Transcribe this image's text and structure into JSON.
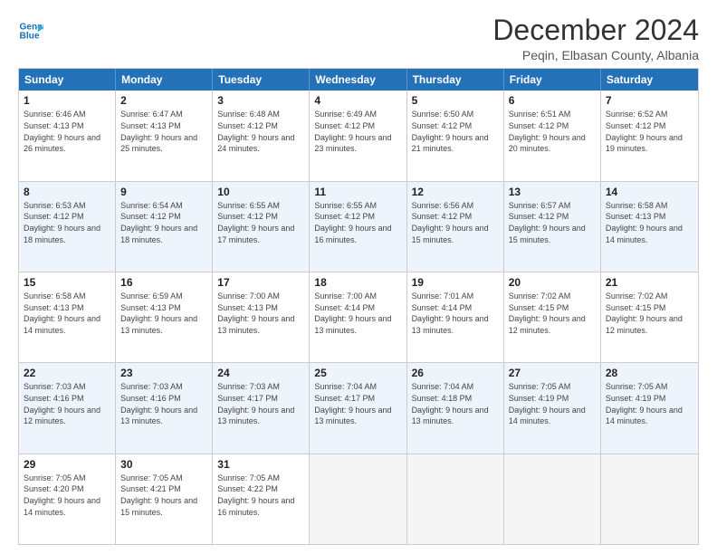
{
  "logo": {
    "line1": "General",
    "line2": "Blue",
    "arrow_color": "#2ea8e0"
  },
  "title": "December 2024",
  "subtitle": "Peqin, Elbasan County, Albania",
  "header_days": [
    "Sunday",
    "Monday",
    "Tuesday",
    "Wednesday",
    "Thursday",
    "Friday",
    "Saturday"
  ],
  "weeks": [
    [
      {
        "num": "1",
        "sunrise": "Sunrise: 6:46 AM",
        "sunset": "Sunset: 4:13 PM",
        "daylight": "Daylight: 9 hours and 26 minutes."
      },
      {
        "num": "2",
        "sunrise": "Sunrise: 6:47 AM",
        "sunset": "Sunset: 4:13 PM",
        "daylight": "Daylight: 9 hours and 25 minutes."
      },
      {
        "num": "3",
        "sunrise": "Sunrise: 6:48 AM",
        "sunset": "Sunset: 4:12 PM",
        "daylight": "Daylight: 9 hours and 24 minutes."
      },
      {
        "num": "4",
        "sunrise": "Sunrise: 6:49 AM",
        "sunset": "Sunset: 4:12 PM",
        "daylight": "Daylight: 9 hours and 23 minutes."
      },
      {
        "num": "5",
        "sunrise": "Sunrise: 6:50 AM",
        "sunset": "Sunset: 4:12 PM",
        "daylight": "Daylight: 9 hours and 21 minutes."
      },
      {
        "num": "6",
        "sunrise": "Sunrise: 6:51 AM",
        "sunset": "Sunset: 4:12 PM",
        "daylight": "Daylight: 9 hours and 20 minutes."
      },
      {
        "num": "7",
        "sunrise": "Sunrise: 6:52 AM",
        "sunset": "Sunset: 4:12 PM",
        "daylight": "Daylight: 9 hours and 19 minutes."
      }
    ],
    [
      {
        "num": "8",
        "sunrise": "Sunrise: 6:53 AM",
        "sunset": "Sunset: 4:12 PM",
        "daylight": "Daylight: 9 hours and 18 minutes."
      },
      {
        "num": "9",
        "sunrise": "Sunrise: 6:54 AM",
        "sunset": "Sunset: 4:12 PM",
        "daylight": "Daylight: 9 hours and 18 minutes."
      },
      {
        "num": "10",
        "sunrise": "Sunrise: 6:55 AM",
        "sunset": "Sunset: 4:12 PM",
        "daylight": "Daylight: 9 hours and 17 minutes."
      },
      {
        "num": "11",
        "sunrise": "Sunrise: 6:55 AM",
        "sunset": "Sunset: 4:12 PM",
        "daylight": "Daylight: 9 hours and 16 minutes."
      },
      {
        "num": "12",
        "sunrise": "Sunrise: 6:56 AM",
        "sunset": "Sunset: 4:12 PM",
        "daylight": "Daylight: 9 hours and 15 minutes."
      },
      {
        "num": "13",
        "sunrise": "Sunrise: 6:57 AM",
        "sunset": "Sunset: 4:12 PM",
        "daylight": "Daylight: 9 hours and 15 minutes."
      },
      {
        "num": "14",
        "sunrise": "Sunrise: 6:58 AM",
        "sunset": "Sunset: 4:13 PM",
        "daylight": "Daylight: 9 hours and 14 minutes."
      }
    ],
    [
      {
        "num": "15",
        "sunrise": "Sunrise: 6:58 AM",
        "sunset": "Sunset: 4:13 PM",
        "daylight": "Daylight: 9 hours and 14 minutes."
      },
      {
        "num": "16",
        "sunrise": "Sunrise: 6:59 AM",
        "sunset": "Sunset: 4:13 PM",
        "daylight": "Daylight: 9 hours and 13 minutes."
      },
      {
        "num": "17",
        "sunrise": "Sunrise: 7:00 AM",
        "sunset": "Sunset: 4:13 PM",
        "daylight": "Daylight: 9 hours and 13 minutes."
      },
      {
        "num": "18",
        "sunrise": "Sunrise: 7:00 AM",
        "sunset": "Sunset: 4:14 PM",
        "daylight": "Daylight: 9 hours and 13 minutes."
      },
      {
        "num": "19",
        "sunrise": "Sunrise: 7:01 AM",
        "sunset": "Sunset: 4:14 PM",
        "daylight": "Daylight: 9 hours and 13 minutes."
      },
      {
        "num": "20",
        "sunrise": "Sunrise: 7:02 AM",
        "sunset": "Sunset: 4:15 PM",
        "daylight": "Daylight: 9 hours and 12 minutes."
      },
      {
        "num": "21",
        "sunrise": "Sunrise: 7:02 AM",
        "sunset": "Sunset: 4:15 PM",
        "daylight": "Daylight: 9 hours and 12 minutes."
      }
    ],
    [
      {
        "num": "22",
        "sunrise": "Sunrise: 7:03 AM",
        "sunset": "Sunset: 4:16 PM",
        "daylight": "Daylight: 9 hours and 12 minutes."
      },
      {
        "num": "23",
        "sunrise": "Sunrise: 7:03 AM",
        "sunset": "Sunset: 4:16 PM",
        "daylight": "Daylight: 9 hours and 13 minutes."
      },
      {
        "num": "24",
        "sunrise": "Sunrise: 7:03 AM",
        "sunset": "Sunset: 4:17 PM",
        "daylight": "Daylight: 9 hours and 13 minutes."
      },
      {
        "num": "25",
        "sunrise": "Sunrise: 7:04 AM",
        "sunset": "Sunset: 4:17 PM",
        "daylight": "Daylight: 9 hours and 13 minutes."
      },
      {
        "num": "26",
        "sunrise": "Sunrise: 7:04 AM",
        "sunset": "Sunset: 4:18 PM",
        "daylight": "Daylight: 9 hours and 13 minutes."
      },
      {
        "num": "27",
        "sunrise": "Sunrise: 7:05 AM",
        "sunset": "Sunset: 4:19 PM",
        "daylight": "Daylight: 9 hours and 14 minutes."
      },
      {
        "num": "28",
        "sunrise": "Sunrise: 7:05 AM",
        "sunset": "Sunset: 4:19 PM",
        "daylight": "Daylight: 9 hours and 14 minutes."
      }
    ],
    [
      {
        "num": "29",
        "sunrise": "Sunrise: 7:05 AM",
        "sunset": "Sunset: 4:20 PM",
        "daylight": "Daylight: 9 hours and 14 minutes."
      },
      {
        "num": "30",
        "sunrise": "Sunrise: 7:05 AM",
        "sunset": "Sunset: 4:21 PM",
        "daylight": "Daylight: 9 hours and 15 minutes."
      },
      {
        "num": "31",
        "sunrise": "Sunrise: 7:05 AM",
        "sunset": "Sunset: 4:22 PM",
        "daylight": "Daylight: 9 hours and 16 minutes."
      },
      null,
      null,
      null,
      null
    ]
  ]
}
